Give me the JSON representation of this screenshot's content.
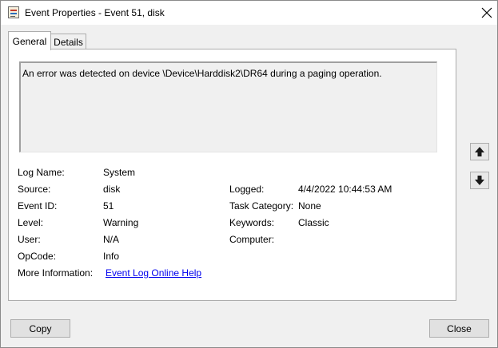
{
  "window": {
    "title": "Event Properties - Event 51, disk"
  },
  "tabs": [
    {
      "label": "General",
      "active": true
    },
    {
      "label": "Details",
      "active": false
    }
  ],
  "event": {
    "description": "An error was detected on device \\Device\\Harddisk2\\DR64 during a paging operation.",
    "left_fields": [
      {
        "label": "Log Name:",
        "value": "System"
      },
      {
        "label": "Source:",
        "value": "disk"
      },
      {
        "label": "Event ID:",
        "value": "51"
      },
      {
        "label": "Level:",
        "value": "Warning"
      },
      {
        "label": "User:",
        "value": "N/A"
      },
      {
        "label": "OpCode:",
        "value": "Info"
      }
    ],
    "right_fields": [
      {
        "label": "Logged:",
        "value": "4/4/2022 10:44:53 AM"
      },
      {
        "label": "Task Category:",
        "value": "None"
      },
      {
        "label": "Keywords:",
        "value": "Classic"
      },
      {
        "label": "Computer:",
        "value": ""
      }
    ],
    "more_info": {
      "label": "More Information:",
      "link_text": "Event Log Online Help"
    }
  },
  "nav": {
    "up_icon": "arrow-up-icon",
    "down_icon": "arrow-down-icon"
  },
  "buttons": {
    "copy": "Copy",
    "close": "Close"
  },
  "icons": {
    "app": "event-viewer-icon",
    "close": "close-icon"
  }
}
